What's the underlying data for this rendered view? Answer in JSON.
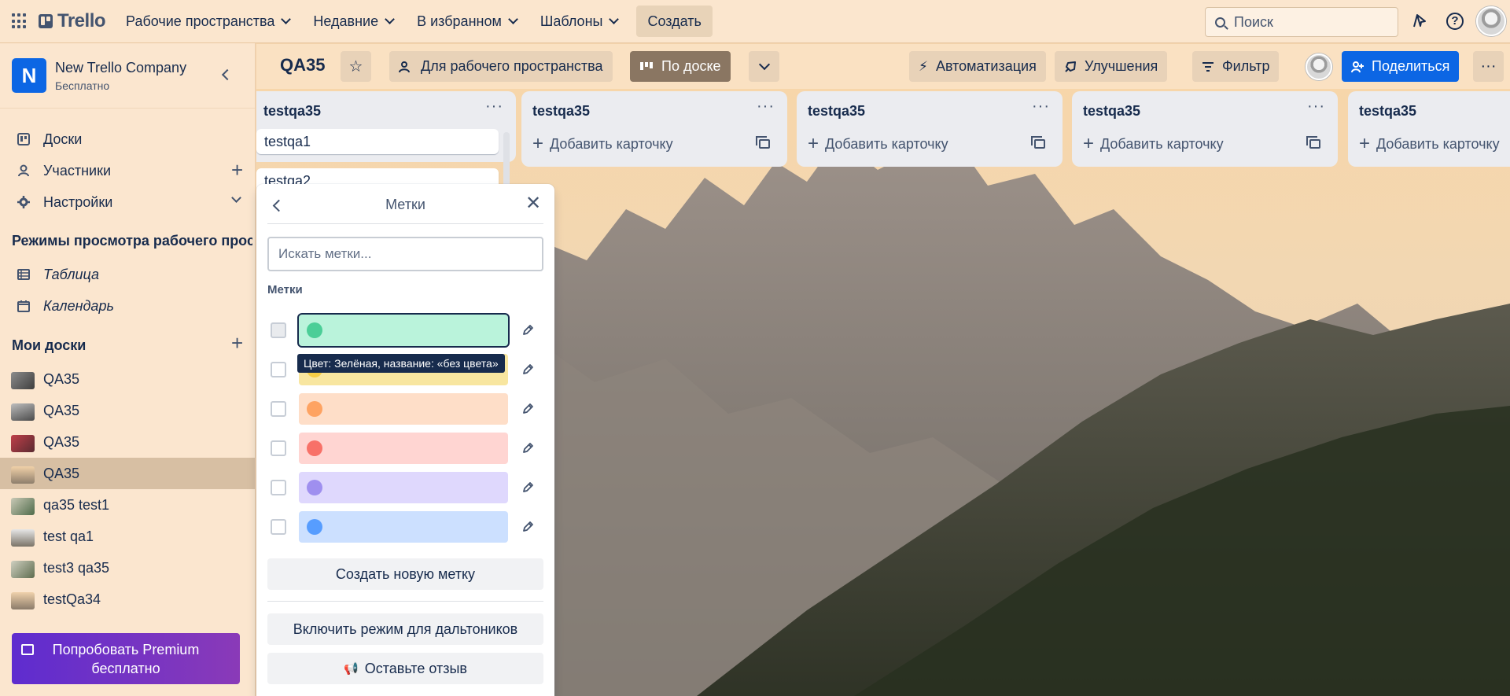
{
  "topnav": {
    "logo": "Trello",
    "items": [
      "Рабочие пространства",
      "Недавние",
      "В избранном",
      "Шаблоны"
    ],
    "create": "Создать",
    "search_placeholder": "Поиск"
  },
  "sidebar": {
    "workspace_letter": "N",
    "workspace_name": "New Trello Company",
    "workspace_plan": "Бесплатно",
    "nav": [
      {
        "label": "Доски",
        "icon": "board-icon"
      },
      {
        "label": "Участники",
        "icon": "person-icon"
      },
      {
        "label": "Настройки",
        "icon": "gear-icon"
      }
    ],
    "views_title": "Режимы просмотра рабочего прос...",
    "views": [
      {
        "label": "Таблица",
        "icon": "table-icon"
      },
      {
        "label": "Календарь",
        "icon": "calendar-icon"
      }
    ],
    "my_boards_title": "Мои доски",
    "boards": [
      "QA35",
      "QA35",
      "QA35",
      "QA35",
      "qa35 test1",
      "test qa1",
      "test3 qa35",
      "testQa34"
    ],
    "premium_label": "Попробовать Premium бесплатно"
  },
  "boardbar": {
    "title": "QA35",
    "visibility": "Для рабочего пространства",
    "view": "По доске",
    "automation": "Автоматизация",
    "improvements": "Улучшения",
    "filter": "Фильтр",
    "share": "Поделиться"
  },
  "lists": [
    {
      "title": "testqa35",
      "cards": [
        "testqa1",
        "testqa2"
      ],
      "add": ""
    },
    {
      "title": "testqa35",
      "cards": [],
      "add": "Добавить карточку"
    },
    {
      "title": "testqa35",
      "cards": [],
      "add": "Добавить карточку"
    },
    {
      "title": "testqa35",
      "cards": [],
      "add": "Добавить карточку"
    },
    {
      "title": "testqa35",
      "cards": [],
      "add": "Добавить карточку"
    }
  ],
  "labels_popover": {
    "title": "Метки",
    "search_placeholder": "Искать метки...",
    "section": "Метки",
    "labels": [
      {
        "color": "green",
        "bar": "#baf3db",
        "dot": "#4bce97"
      },
      {
        "color": "yellow",
        "bar": "#f8e6a0",
        "dot": "#f5cd47"
      },
      {
        "color": "orange",
        "bar": "#fedec8",
        "dot": "#fea362"
      },
      {
        "color": "red",
        "bar": "#ffd5d2",
        "dot": "#f87168"
      },
      {
        "color": "purple",
        "bar": "#dfd8fd",
        "dot": "#9f8fef"
      },
      {
        "color": "blue",
        "bar": "#cce0ff",
        "dot": "#579dff"
      }
    ],
    "tooltip": "Цвет: Зелёная, название: «без цвета»",
    "create_label": "Создать новую метку",
    "colorblind": "Включить режим для дальтоников",
    "feedback": "Оставьте отзыв"
  }
}
